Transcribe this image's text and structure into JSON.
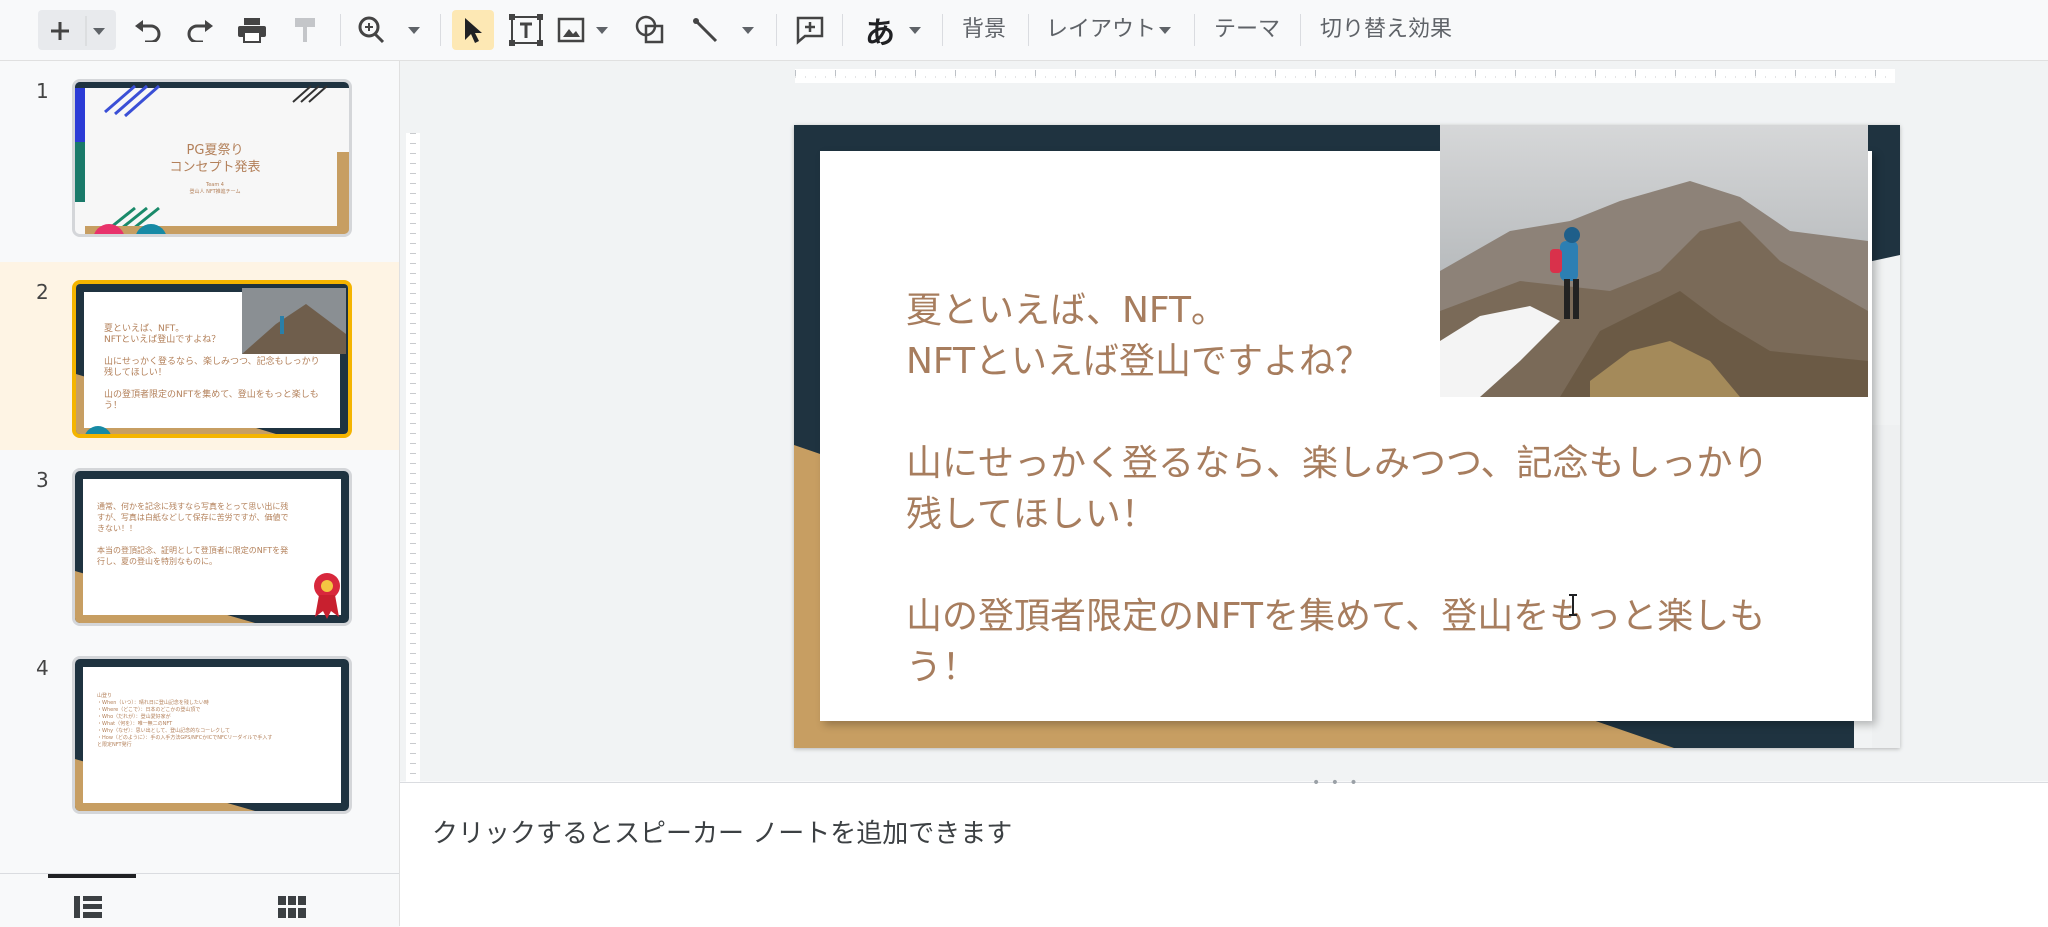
{
  "toolbar": {
    "new_icon": "plus-icon",
    "undo_icon": "undo-icon",
    "redo_icon": "redo-icon",
    "print_icon": "print-icon",
    "paint_format_icon": "paint-format-icon",
    "zoom_icon": "zoom-icon",
    "select_icon": "cursor-icon",
    "textbox_icon": "textbox-icon",
    "image_icon": "image-icon",
    "shape_icon": "shape-icon",
    "line_icon": "line-icon",
    "comment_icon": "add-comment-icon",
    "input_tool": "あ",
    "background": "背景",
    "layout": "レイアウト",
    "theme": "テーマ",
    "transition": "切り替え効果"
  },
  "filmstrip": {
    "slides": [
      {
        "number": "1",
        "title": "PG夏祭り\nコンセプト発表",
        "subtitle": "Team 4\n登山人 NFT推進チーム"
      },
      {
        "number": "2",
        "text": "夏といえば、NFT。\nNFTといえば登山ですよね？\n\n山にせっかく登るなら、楽しみつつ、記念もしっかり\n残してほしい！\n\n山の登頂者限定のNFTを集めて、登山をもっと楽しも\nう！"
      },
      {
        "number": "3",
        "text": "通常、何かを記念に残すなら写真をとって思い出に残\nすが、写真は白紙などして保存に苦労ですが、価値で\nきない！！\n\n本当の登頂記念、証明として登頂者に限定のNFTを発\n行し、夏の登山を特別なものに。"
      },
      {
        "number": "4",
        "text": "山登り\n・When（いつ）：晴れ日に登山記念を残したい時\n・Where（どこで）：日本のどこかの登山頂で\n・Who（だれが）：登山愛好家が\n・What（何を）：唯一無二のNFT\n・Why（なぜ）：思い出として、登山記念的なコーレクして\n・How（どのように）：手の入手方法GPS/NFCかICでNFCリーダイルで手入す\nと限定NFT発行"
      }
    ]
  },
  "slide": {
    "text": "夏といえば、NFT。\nNFTといえば登山ですよね？\n\n山にせっかく登るなら、楽しみつつ、記念もしっかり\n残してほしい！\n\n山の登頂者限定のNFTを集めて、登山をもっと楽しも\nう！"
  },
  "notes": {
    "placeholder": "クリックするとスピーカー ノートを追加できます",
    "handle": "• • •"
  },
  "view_switch": {
    "filmstrip_icon": "filmstrip-view-icon",
    "grid_icon": "grid-view-icon"
  },
  "colors": {
    "accent_yellow": "#f4b400",
    "slide_navy": "#1f3340",
    "slide_gold": "#c79e62",
    "slide_text": "#a77d5e"
  }
}
